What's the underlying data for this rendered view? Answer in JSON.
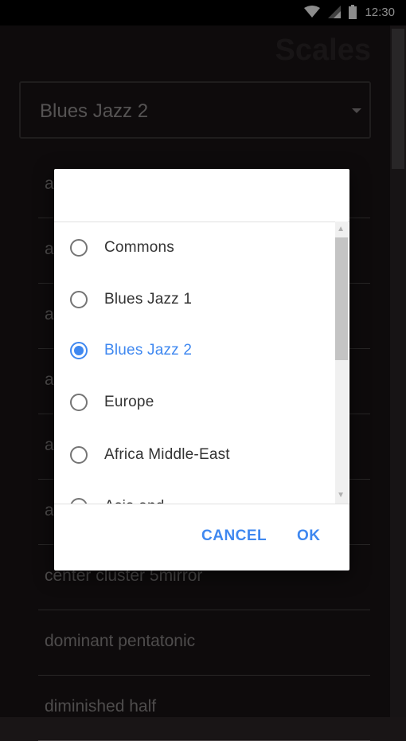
{
  "status_bar": {
    "time": "12:30",
    "icons": [
      "wifi-icon",
      "signal-icon",
      "battery-icon"
    ]
  },
  "app": {
    "title": "Scales",
    "spinner_value": "Blues Jazz 2",
    "list_items": [
      "a",
      "a",
      "a",
      "a",
      "a",
      "a",
      "center cluster 5mirror",
      "dominant pentatonic",
      "diminished half"
    ]
  },
  "dialog": {
    "options": [
      {
        "label": "Commons",
        "selected": false
      },
      {
        "label": "Blues Jazz 1",
        "selected": false
      },
      {
        "label": "Blues Jazz 2",
        "selected": true
      },
      {
        "label": "Europe",
        "selected": false
      },
      {
        "label": "Africa Middle-East",
        "selected": false
      }
    ],
    "partial_option": "Asia and ...",
    "cancel_label": "CANCEL",
    "ok_label": "OK"
  },
  "colors": {
    "accent": "#3f88f0",
    "background": "#1a1516"
  }
}
